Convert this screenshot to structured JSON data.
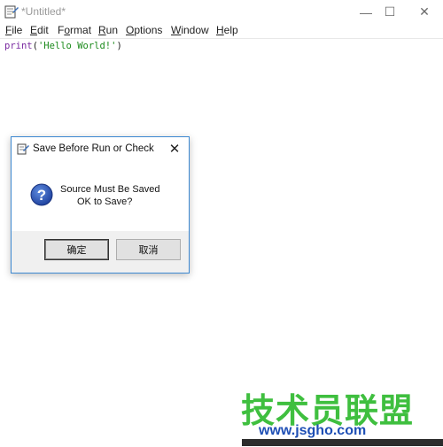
{
  "window": {
    "title": "*Untitled*",
    "controls": {
      "minimize": "—",
      "maximize": "☐",
      "close": "✕"
    }
  },
  "menu": {
    "items": [
      {
        "u": "F",
        "rest": "ile"
      },
      {
        "u": "E",
        "rest": "dit"
      },
      {
        "pre": "F",
        "u": "o",
        "rest": "rmat"
      },
      {
        "u": "R",
        "rest": "un"
      },
      {
        "u": "O",
        "rest": "ptions"
      },
      {
        "u": "W",
        "rest": "indow"
      },
      {
        "u": "H",
        "rest": "elp"
      }
    ]
  },
  "editor": {
    "code_keyword": "print",
    "code_open": "(",
    "code_string": "'Hello World!'",
    "code_close": ")"
  },
  "dialog": {
    "title": "Save Before Run or Check",
    "close": "✕",
    "message_line1": "Source Must Be Saved",
    "message_line2": "OK to Save?",
    "ok_label": "确定",
    "cancel_label": "取消"
  },
  "watermark": {
    "big_text": "技术员联盟",
    "small_text": "www.jsgho.com"
  },
  "colors": {
    "keyword": "#7a2aa0",
    "string": "#1b8a1b",
    "dialog_border": "#3c88d1",
    "watermark_green": "#3fbf3f",
    "watermark_blue": "#1e4fb5"
  }
}
